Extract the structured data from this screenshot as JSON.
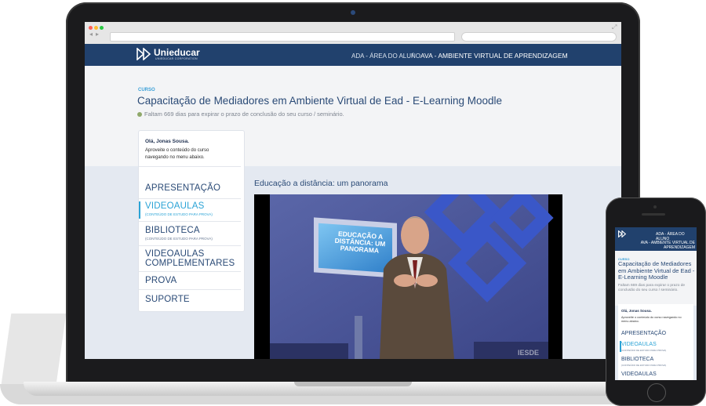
{
  "brand": {
    "name": "Unieducar",
    "tagline": "UNIEDUCAR CORPORATION"
  },
  "header": {
    "ada": "ADA - ÁREA DO ALUNO",
    "separator": "/",
    "ava": "AVA - AMBIENTE VIRTUAL DE APRENDIZAGEM"
  },
  "course": {
    "label": "CURSO",
    "title": "Capacitação de Mediadores em Ambiente Virtual de Ead - E-Learning Moodle",
    "expiry": "Faltam 669 dias para expirar o prazo de conclusão do seu curso / seminário."
  },
  "greeting": {
    "hello": "Olá, Jonas Sousa.",
    "hint": "Aproveite o conteúdo do curso navegando no menu abaixo."
  },
  "menu": [
    {
      "label": "APRESENTAÇÃO",
      "sub": ""
    },
    {
      "label": "VIDEOAULAS",
      "sub": "(CONTEÚDO DE ESTUDO PARA PROVA)"
    },
    {
      "label": "BIBLIOTECA",
      "sub": "(CONTEÚDO DE ESTUDO PARA PROVA)"
    },
    {
      "label": "VIDEOAULAS COMPLEMENTARES",
      "sub": ""
    },
    {
      "label": "PROVA",
      "sub": ""
    },
    {
      "label": "SUPORTE",
      "sub": ""
    }
  ],
  "video": {
    "title": "Educação a distância: um panorama",
    "screen_text": "EDUCAÇÃO A DISTÂNCIA: UM PANORAMA",
    "watermark": "IESDE"
  },
  "phone": {
    "ada": "ADA - ÁREA DO ALUNO",
    "ava": "AVA - AMBIENTE VIRTUAL DE APRENDIZAGEM",
    "menu_visible": [
      "APRESENTAÇÃO",
      "VIDEOAULAS",
      "BIBLIOTECA",
      "VIDEOAULAS"
    ]
  },
  "colors": {
    "header": "#21416d",
    "accent": "#2aa3d6",
    "title": "#2a4a76"
  }
}
